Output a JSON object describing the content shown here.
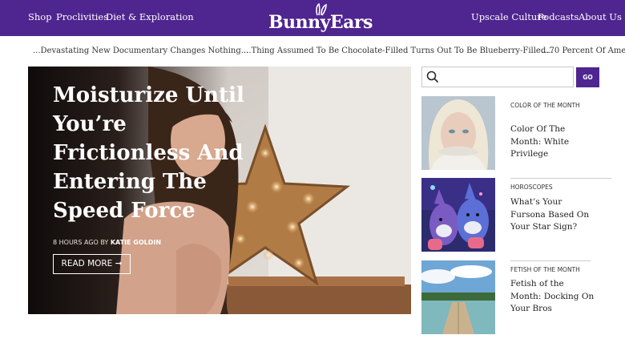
{
  "nav": {
    "left_links": [
      "Shop",
      "Proclivities",
      "Diet & Exploration"
    ],
    "right_links": [
      "Upscale Culture",
      "Podcasts",
      "About Us"
    ],
    "logo_text": "BunnyEars"
  },
  "ticker": [
    "...Devastating New Documentary Changes Nothing...",
    "...Thing Assumed To Be Chocolate-Filled Turns Out To Be Blueberry-Filled...",
    "...70 Percent Of Amer"
  ],
  "hero": {
    "title": "Moisturize Until You’re Frictionless And Entering The Speed Force",
    "meta_prefix": "8 HOURS AGO BY",
    "author": "KATIE GOLDIN",
    "cta": "READ MORE ➞"
  },
  "search": {
    "placeholder": "",
    "button_label": "GO",
    "icon": "search-icon"
  },
  "side_articles": [
    {
      "category": "COLOR OF THE MONTH",
      "title": "Color Of The Month: White Privilege"
    },
    {
      "category": "HOROSCOPES",
      "title": "What’s Your Fursona Based On Your Star Sign?"
    },
    {
      "category": "FETISH OF THE MONTH",
      "title": "Fetish of the Month: Docking On Your Bros"
    }
  ],
  "colors": {
    "brand_purple": "#4f2590"
  }
}
